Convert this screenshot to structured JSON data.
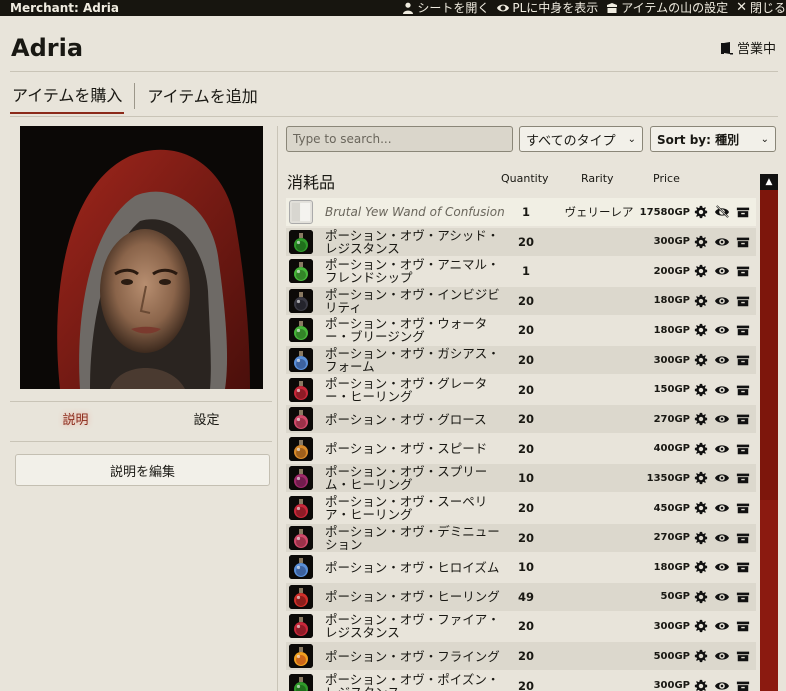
{
  "window": {
    "title": "Merchant: Adria",
    "controls": [
      {
        "label": "シートを開く",
        "icon": "user-icon"
      },
      {
        "label": "PLに中身を表示",
        "icon": "eye-icon"
      },
      {
        "label": "アイテムの山の設定",
        "icon": "box-icon"
      },
      {
        "label": "閉じる",
        "icon": "close-icon"
      }
    ]
  },
  "merchant": {
    "name": "Adria",
    "status": "営業中"
  },
  "tabs": [
    "アイテムを購入",
    "アイテムを追加"
  ],
  "sidebar": {
    "subtabs": [
      "説明",
      "設定"
    ],
    "edit_button": "説明を編集"
  },
  "filters": {
    "search_placeholder": "Type to search...",
    "type_select": "すべてのタイプ",
    "sort_select": "Sort by: 種別"
  },
  "list": {
    "category": "消耗品",
    "headers": {
      "quantity": "Quantity",
      "rarity": "Rarity",
      "price": "Price"
    },
    "items": [
      {
        "name": "Brutal Yew Wand of Confusion",
        "qty": "1",
        "rarity": "ヴェリーレア",
        "price": "17580GP",
        "icon": "wand",
        "hidden": true
      },
      {
        "name": "ポーション・オヴ・アシッド・レジスタンス",
        "qty": "20",
        "rarity": "",
        "price": "300GP",
        "icon": "green"
      },
      {
        "name": "ポーション・オヴ・アニマル・フレンドシップ",
        "qty": "1",
        "rarity": "",
        "price": "200GP",
        "icon": "green2"
      },
      {
        "name": "ポーション・オヴ・インビジビリティ",
        "qty": "20",
        "rarity": "",
        "price": "180GP",
        "icon": "dark"
      },
      {
        "name": "ポーション・オヴ・ウォーター・ブリージング",
        "qty": "20",
        "rarity": "",
        "price": "180GP",
        "icon": "green2"
      },
      {
        "name": "ポーション・オヴ・ガシアス・フォーム",
        "qty": "20",
        "rarity": "",
        "price": "300GP",
        "icon": "blue"
      },
      {
        "name": "ポーション・オヴ・グレーター・ヒーリング",
        "qty": "20",
        "rarity": "",
        "price": "150GP",
        "icon": "red"
      },
      {
        "name": "ポーション・オヴ・グロース",
        "qty": "20",
        "rarity": "",
        "price": "270GP",
        "icon": "pink"
      },
      {
        "name": "ポーション・オヴ・スピード",
        "qty": "20",
        "rarity": "",
        "price": "400GP",
        "icon": "orange"
      },
      {
        "name": "ポーション・オヴ・スプリーム・ヒーリング",
        "qty": "10",
        "rarity": "",
        "price": "1350GP",
        "icon": "purple"
      },
      {
        "name": "ポーション・オヴ・スーペリア・ヒーリング",
        "qty": "20",
        "rarity": "",
        "price": "450GP",
        "icon": "red"
      },
      {
        "name": "ポーション・オヴ・デミニューション",
        "qty": "20",
        "rarity": "",
        "price": "270GP",
        "icon": "pink"
      },
      {
        "name": "ポーション・オヴ・ヒロイズム",
        "qty": "10",
        "rarity": "",
        "price": "180GP",
        "icon": "blue"
      },
      {
        "name": "ポーション・オヴ・ヒーリング",
        "qty": "49",
        "rarity": "",
        "price": "50GP",
        "icon": "redvial"
      },
      {
        "name": "ポーション・オヴ・ファイア・レジスタンス",
        "qty": "20",
        "rarity": "",
        "price": "300GP",
        "icon": "red"
      },
      {
        "name": "ポーション・オヴ・フライング",
        "qty": "20",
        "rarity": "",
        "price": "500GP",
        "icon": "fire"
      },
      {
        "name": "ポーション・オヴ・ポイズン・レジスタンス",
        "qty": "20",
        "rarity": "",
        "price": "300GP",
        "icon": "green"
      }
    ]
  }
}
